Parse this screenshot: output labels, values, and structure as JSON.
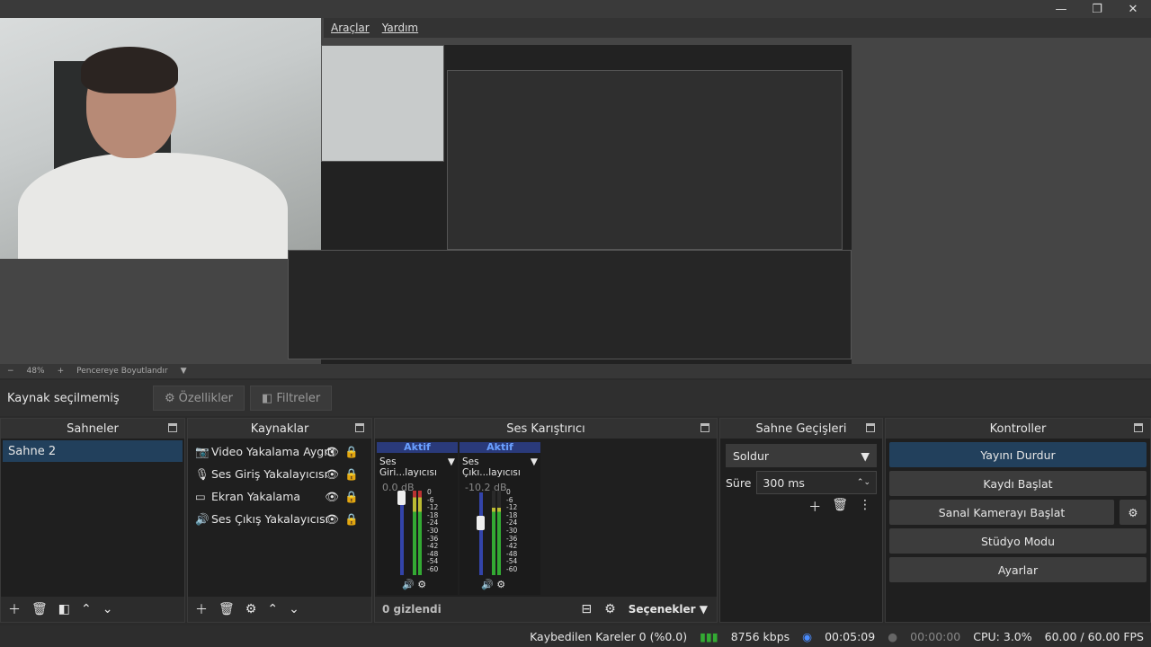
{
  "menu": {
    "tools": "Araçlar",
    "help": "Yardım"
  },
  "window_controls": {
    "minimize": "—",
    "restore": "❐",
    "close": "✕"
  },
  "preview_strip": {
    "zoom_minus": "−",
    "zoom": "48%",
    "zoom_plus": "+",
    "fit_label": "Pencereye Boyutlandır"
  },
  "source_bar": {
    "label": "Kaynak seçilmemiş",
    "properties": "Özellikler",
    "filters": "Filtreler"
  },
  "docks": {
    "scenes": {
      "title": "Sahneler",
      "items": [
        "Sahne 2"
      ]
    },
    "sources": {
      "title": "Kaynaklar",
      "items": [
        "Video Yakalama Aygıtı",
        "Ses Giriş Yakalayıcısı",
        "Ekran Yakalama",
        "Ses Çıkış Yakalayıcısı"
      ]
    },
    "mixer": {
      "title": "Ses Karıştırıcı",
      "channels": [
        {
          "active": "Aktif",
          "name": "Ses Giri...layıcısı",
          "db": "0.0 dB",
          "level": 1.0
        },
        {
          "active": "Aktif",
          "name": "Ses Çıkı...layıcısı",
          "db": "-10.2 dB",
          "level": 0.72
        }
      ],
      "scale": [
        "0",
        "-6",
        "-12",
        "-18",
        "-24",
        "-30",
        "-36",
        "-42",
        "-48",
        "-54",
        "-60"
      ],
      "hidden": "0 gizlendi",
      "options": "Seçenekler"
    },
    "transitions": {
      "title": "Sahne Geçişleri",
      "selected": "Soldur",
      "duration_label": "Süre",
      "duration": "300 ms"
    },
    "controls": {
      "title": "Kontroller",
      "stop_stream": "Yayını Durdur",
      "start_record": "Kaydı Başlat",
      "virtual_cam": "Sanal Kamerayı Başlat",
      "studio": "Stüdyo Modu",
      "settings": "Ayarlar"
    }
  },
  "status": {
    "dropped": "Kaybedilen Kareler 0 (%0.0)",
    "bitrate": "8756 kbps",
    "stream_time": "00:05:09",
    "rec_time": "00:00:00",
    "cpu": "CPU: 3.0%",
    "fps": "60.00 / 60.00 FPS"
  },
  "colors": {
    "accent": "#22405c",
    "active_channel": "#2a3a7a",
    "meter_green": "#33aa33"
  }
}
